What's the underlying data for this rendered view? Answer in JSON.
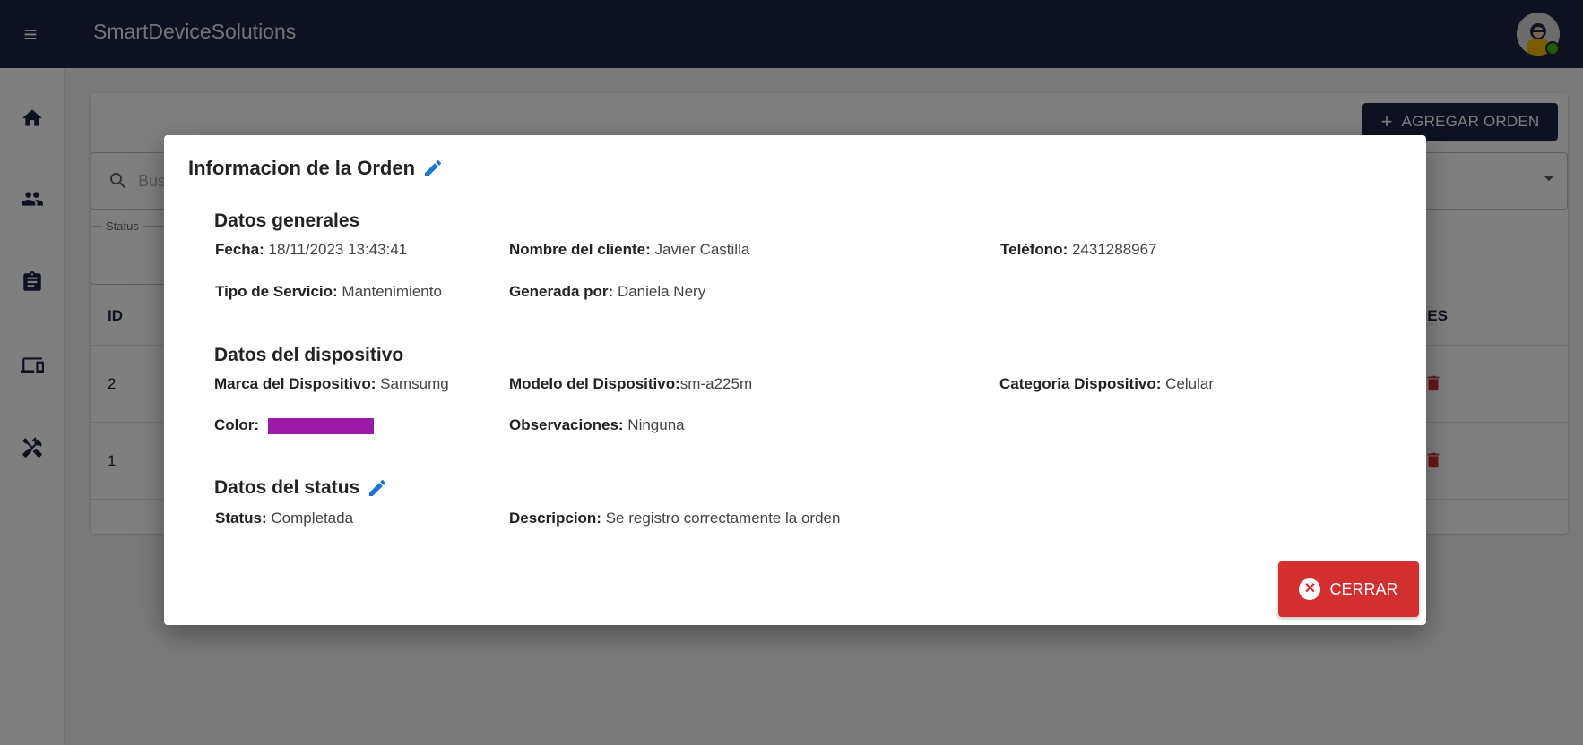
{
  "app": {
    "title": "SmartDeviceSolutions"
  },
  "sidebar": {
    "items": [
      {
        "icon": "home-icon"
      },
      {
        "icon": "people-icon"
      },
      {
        "icon": "clipboard-icon"
      },
      {
        "icon": "devices-icon"
      },
      {
        "icon": "tools-icon"
      }
    ]
  },
  "page": {
    "add_order_label": "AGREGAR ORDEN",
    "search_placeholder": "Bus",
    "status_filter_label": "Status",
    "table": {
      "headers": {
        "id": "ID",
        "acciones": "NES"
      },
      "rows": [
        {
          "id": "2"
        },
        {
          "id": "1"
        }
      ]
    }
  },
  "modal": {
    "title": "Informacion de la Orden",
    "general": {
      "title": "Datos generales",
      "fecha_label": "Fecha:",
      "fecha": "18/11/2023 13:43:41",
      "cliente_label": "Nombre del cliente:",
      "cliente": "Javier Castilla",
      "telefono_label": "Teléfono:",
      "telefono": "2431288967",
      "servicio_label": "Tipo de Servicio:",
      "servicio": "Mantenimiento",
      "generada_label": "Generada por:",
      "generada": "Daniela Nery"
    },
    "device": {
      "title": "Datos del dispositivo",
      "marca_label": "Marca del Dispositivo:",
      "marca": "Samsumg",
      "modelo_label": "Modelo del Dispositivo:",
      "modelo": "sm-a225m",
      "categoria_label": "Categoria Dispositivo:",
      "categoria": "Celular",
      "color_label": "Color:",
      "color_hex": "#9c1aa8",
      "obs_label": "Observaciones:",
      "obs": "Ninguna"
    },
    "status": {
      "title": "Datos del status",
      "status_label": "Status:",
      "status": "Completada",
      "desc_label": "Descripcion:",
      "desc": "Se registro correctamente la orden"
    },
    "close_label": "CERRAR"
  },
  "colors": {
    "topbar": "#1c2340",
    "accent_edit": "#1976d2",
    "danger": "#d32f2f"
  }
}
